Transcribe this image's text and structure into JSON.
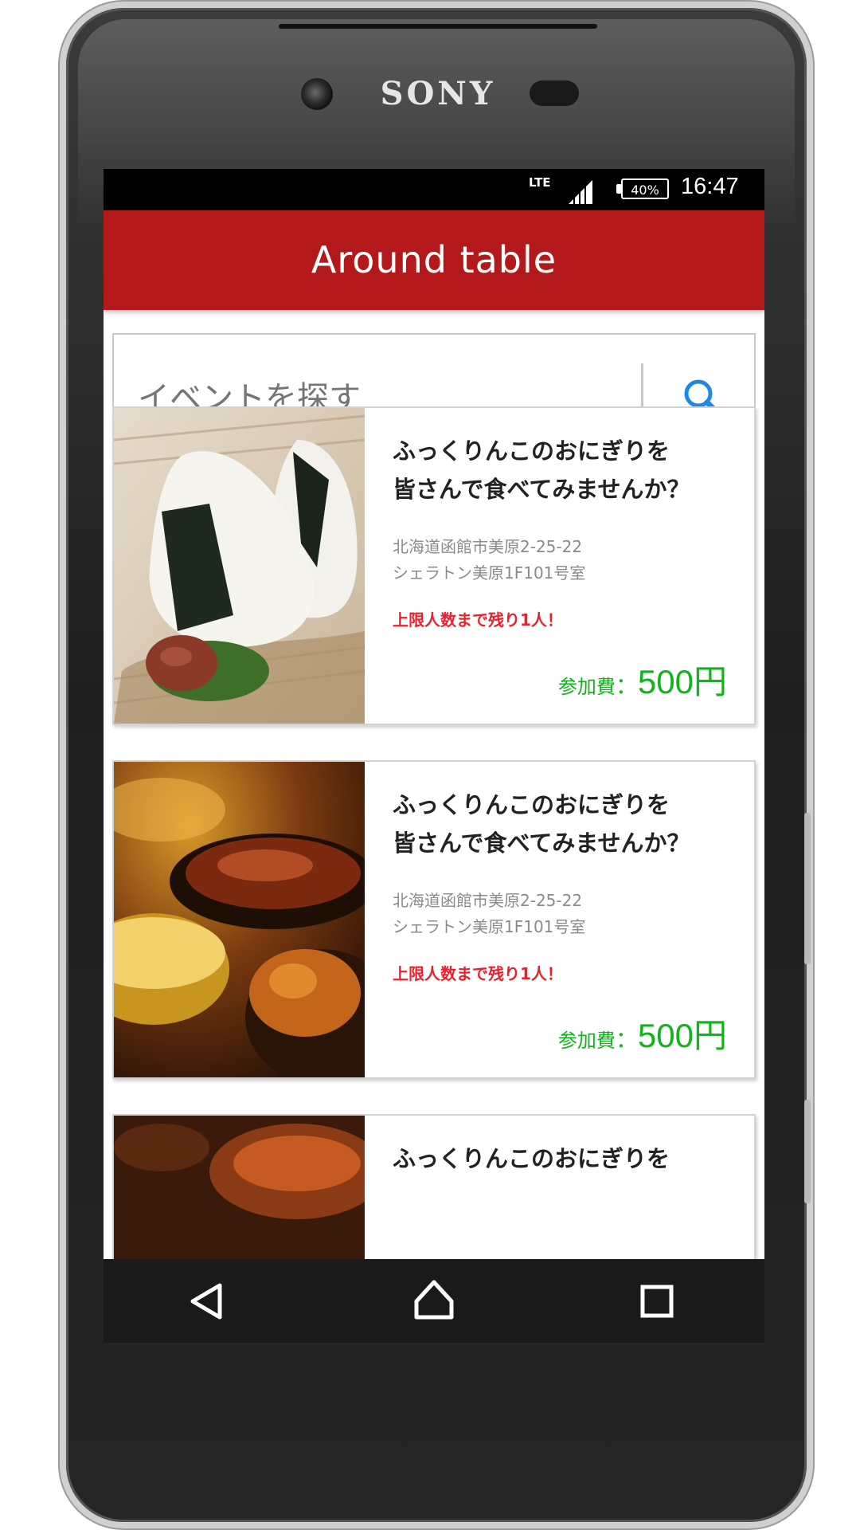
{
  "device": {
    "brand": "SONY"
  },
  "status_bar": {
    "network": "LTE",
    "battery": "40%",
    "time": "16:47"
  },
  "app_bar": {
    "title": "Around table"
  },
  "search": {
    "placeholder": "イベントを探す",
    "button_icon": "search-icon"
  },
  "colors": {
    "app_bar": "#b3191b",
    "accent_blue": "#1e88e5",
    "remaining": "#e8212e",
    "fee": "#12b31c"
  },
  "events": [
    {
      "image": "onigiri-photo",
      "title_line1": "ふっくりんこのおにぎりを",
      "title_line2": "皆さんで食べてみませんか？",
      "address_line1": "北海道函館市美原2-25-22",
      "address_line2": "シェラトン美原1F101号室",
      "remaining": "上限人数まで残り1人！",
      "fee_label": "参加費",
      "fee_sep": "：",
      "fee_value": "500円"
    },
    {
      "image": "dinner-photo",
      "title_line1": "ふっくりんこのおにぎりを",
      "title_line2": "皆さんで食べてみませんか？",
      "address_line1": "北海道函館市美原2-25-22",
      "address_line2": "シェラトン美原1F101号室",
      "remaining": "上限人数まで残り1人！",
      "fee_label": "参加費",
      "fee_sep": "：",
      "fee_value": "500円"
    },
    {
      "image": "dish-photo",
      "title_line1": "ふっくりんこのおにぎりを"
    }
  ],
  "nav_bar": {
    "back": "back-icon",
    "home": "home-icon",
    "recents": "recents-icon"
  }
}
